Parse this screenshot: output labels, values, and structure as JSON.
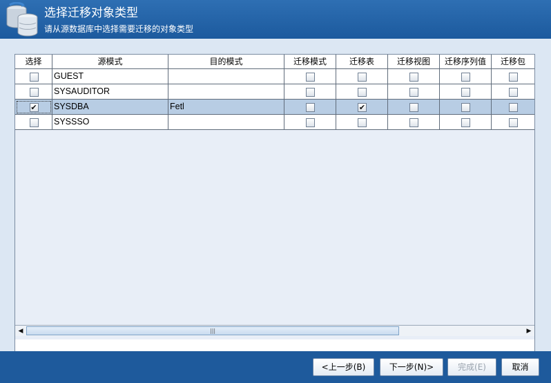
{
  "header": {
    "title": "选择迁移对象类型",
    "subtitle": "请从源数据库中选择需要迁移的对象类型"
  },
  "table": {
    "columns": [
      "选择",
      "源模式",
      "目的模式",
      "迁移模式",
      "迁移表",
      "迁移视图",
      "迁移序列值",
      "迁移包"
    ],
    "rows": [
      {
        "select": "",
        "source": "GUEST",
        "target": "",
        "mode": "",
        "table": "",
        "view": "",
        "seq": "",
        "pkg": ""
      },
      {
        "select": "",
        "source": "SYSAUDITOR",
        "target": "",
        "mode": "",
        "table": "",
        "view": "",
        "seq": "",
        "pkg": ""
      },
      {
        "select": "✔",
        "source": "SYSDBA",
        "target": "Fetl",
        "mode": "",
        "table": "✔",
        "view": "",
        "seq": "",
        "pkg": ""
      },
      {
        "select": "",
        "source": "SYSSSO",
        "target": "",
        "mode": "",
        "table": "",
        "view": "",
        "seq": "",
        "pkg": ""
      }
    ],
    "selected_row": 2
  },
  "scrollbar": {
    "left_arrow": "◀",
    "right_arrow": "▶",
    "grip": "|||"
  },
  "footer": {
    "prev": "<上一步(B)",
    "next": "下一步(N)>",
    "finish": "完成(E)",
    "cancel": "取消"
  },
  "colors": {
    "accent": "#1e5a9c",
    "panel": "#dce7f3",
    "selected_row": "#b8cde4"
  }
}
